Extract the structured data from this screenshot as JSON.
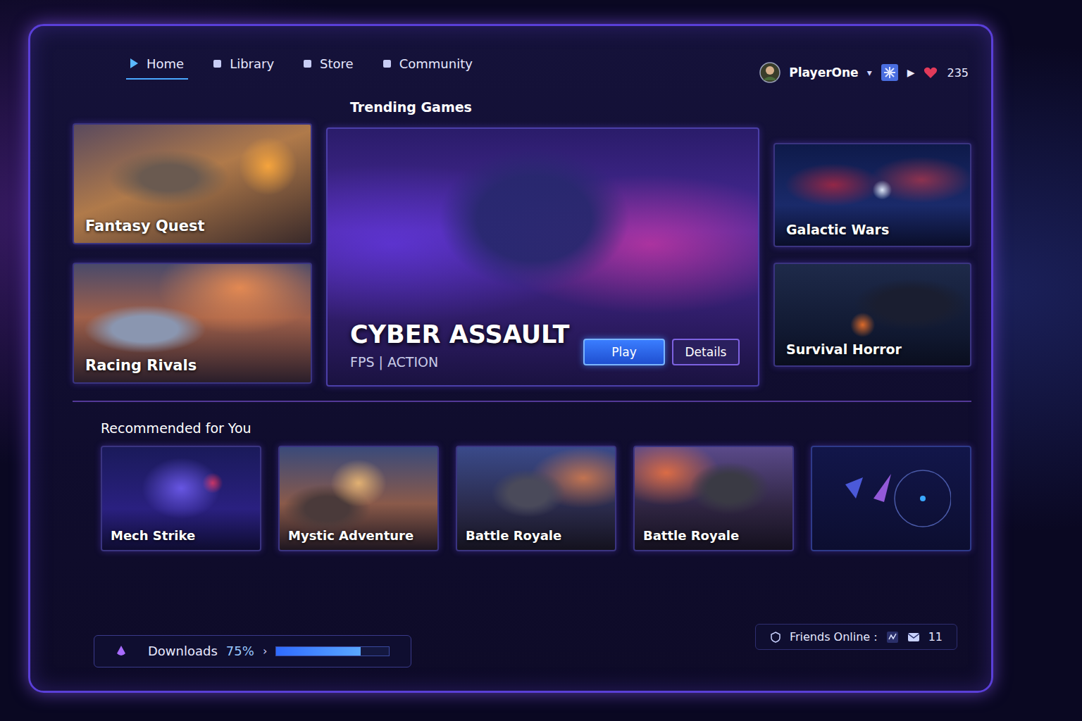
{
  "nav": {
    "tabs": [
      {
        "label": "Home",
        "selected": true
      },
      {
        "label": "Library",
        "selected": false
      },
      {
        "label": "Store",
        "selected": false
      },
      {
        "label": "Community",
        "selected": false
      }
    ]
  },
  "user": {
    "name": "PlayerOne",
    "caret": "▾",
    "play": "▶",
    "badge": "235"
  },
  "trending": {
    "title": "Trending Games",
    "left": [
      {
        "title": "Fantasy Quest"
      },
      {
        "title": "Racing Rivals"
      }
    ],
    "featured": {
      "title": "CYBER ASSAULT",
      "genres": "FPS | ACTION",
      "buttons": [
        {
          "label": "Play",
          "primary": true
        },
        {
          "label": "Details",
          "primary": false
        }
      ]
    },
    "right": [
      {
        "title": "Galactic Wars"
      },
      {
        "title": "Survival Horror"
      }
    ]
  },
  "recommended": {
    "title": "Recommended for You",
    "items": [
      {
        "title": "Mech Strike",
        "kind": "game"
      },
      {
        "title": "Mystic Adventure",
        "kind": "game"
      },
      {
        "title": "Battle Royale",
        "kind": "game"
      },
      {
        "title": "Battle Royale",
        "kind": "game"
      },
      {
        "title": "",
        "kind": "placeholder"
      }
    ]
  },
  "friends": {
    "label": "Friends Online :",
    "count": "11"
  },
  "downloads": {
    "label": "Downloads",
    "percent": "75%",
    "chevron": "›",
    "level": 0.75
  }
}
